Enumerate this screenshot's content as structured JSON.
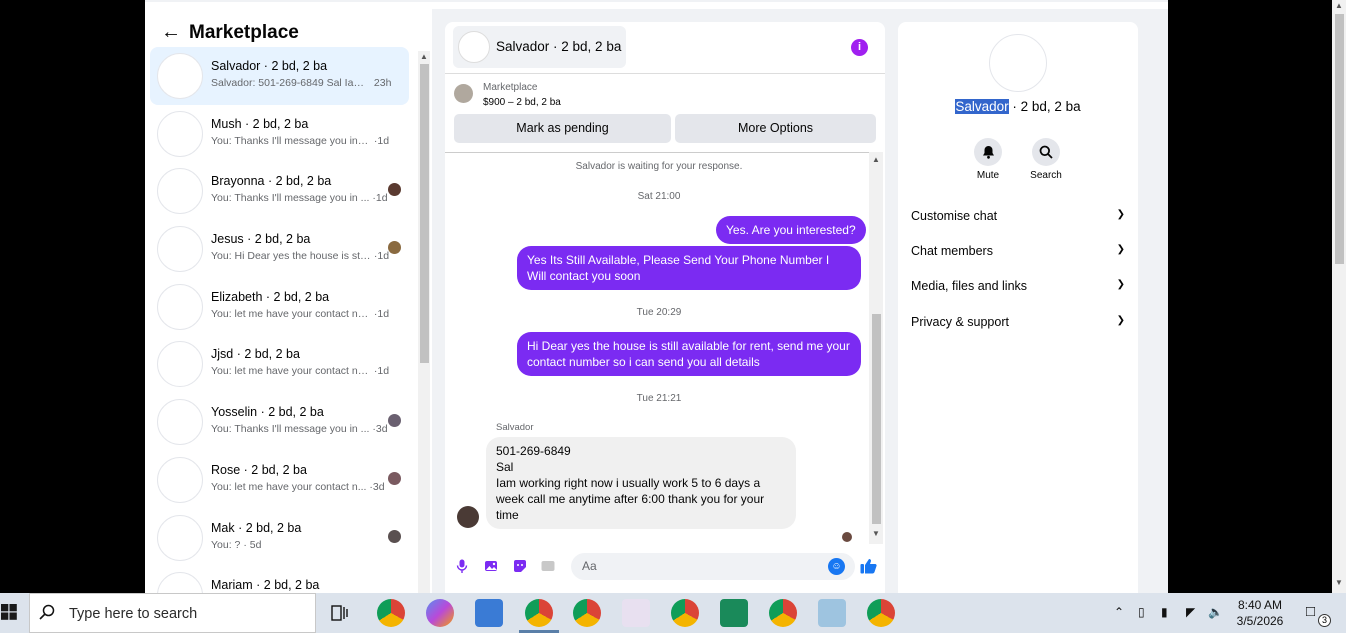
{
  "left_panel": {
    "title": "Marketplace",
    "conversations": [
      {
        "name": "Salvador · 2 bd, 2 ba",
        "preview": "Salvador: 501-269-6849 Sal Iam ...",
        "time": "23h",
        "active": true
      },
      {
        "name": "Mush · 2 bd, 2 ba",
        "preview": "You: Thanks I'll message you in a ...",
        "time": "·1d"
      },
      {
        "name": "Brayonna · 2 bd, 2 ba",
        "preview": "You: Thanks I'll message you in ...",
        "time": "·1d"
      },
      {
        "name": "Jesus · 2 bd, 2 ba",
        "preview": "You: Hi Dear yes the house is sti...",
        "time": "·1d"
      },
      {
        "name": "Elizabeth · 2 bd, 2 ba",
        "preview": "You: let me have your contact nu...",
        "time": "·1d"
      },
      {
        "name": "Jjsd · 2 bd, 2 ba",
        "preview": "You: let me have your contact nu...",
        "time": "·1d"
      },
      {
        "name": "Yosselin · 2 bd, 2 ba",
        "preview": "You: Thanks I'll message you in ...",
        "time": "·3d"
      },
      {
        "name": "Rose · 2 bd, 2 ba",
        "preview": "You: let me have your contact n...",
        "time": "·3d"
      },
      {
        "name": "Mak · 2 bd, 2 ba",
        "preview": "You: ?",
        "time": "· 5d"
      },
      {
        "name": "Mariam · 2 bd, 2 ba",
        "preview": "",
        "time": ""
      }
    ]
  },
  "chat": {
    "header_title": "Salvador · 2 bd, 2 ba",
    "listing_source": "Marketplace",
    "listing_detail": "$900 – 2 bd, 2 ba",
    "mark_pending_label": "Mark as pending",
    "more_options_label": "More Options",
    "waiting_text": "Salvador is waiting for your response.",
    "ts1": "Sat 21:00",
    "msg1": "Yes. Are you interested?",
    "msg2": "Yes Its Still Available, Please Send Your Phone Number I Will contact you soon",
    "ts2": "Tue 20:29",
    "msg3": "Hi Dear yes the house is still available for rent, send me your contact number so i can send you all details",
    "ts3": "Tue 21:21",
    "sender": "Salvador",
    "incoming_lines": [
      "501-269-6849",
      "Sal",
      "Iam working right now i usually work 5 to 6 days a week call me anytime after 6:00 thank you for your time"
    ],
    "composer_placeholder": "Aa"
  },
  "right_panel": {
    "name_highlight": "Salvador",
    "name_rest": " · 2 bd, 2 ba",
    "mute_label": "Mute",
    "search_label": "Search",
    "sections": [
      "Customise chat",
      "Chat members",
      "Media, files and links",
      "Privacy & support"
    ]
  },
  "taskbar": {
    "search_placeholder": "Type here to search",
    "time": "8:40 AM",
    "date": "3/5/2026",
    "notification_count": "3"
  },
  "colors": {
    "outgoing_bubble": "#7b2bf2",
    "accent_blue": "#1877f2",
    "active_conversation": "#e7f3ff"
  }
}
